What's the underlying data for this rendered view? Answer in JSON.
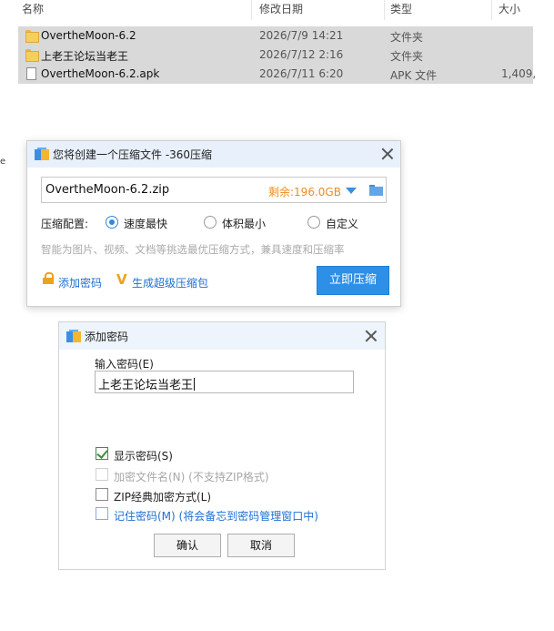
{
  "explorer": {
    "columns": [
      "名称",
      "修改日期",
      "类型",
      "大小"
    ],
    "rows": [
      {
        "name": "OvertheMoon-6.2",
        "date": "2026/7/9 14:21",
        "type": "文件夹",
        "size": "",
        "icon": "folder-icon"
      },
      {
        "name": "上老王论坛当老王",
        "date": "2026/7/12 2:16",
        "type": "文件夹",
        "size": "",
        "icon": "folder-icon"
      },
      {
        "name": "OvertheMoon-6.2.apk",
        "date": "2026/7/11 6:20",
        "type": "APK 文件",
        "size": "1,409,",
        "icon": "file-icon"
      }
    ]
  },
  "compress_dialog": {
    "title": "您将创建一个压缩文件 -360压缩",
    "path_value": "OvertheMoon-6.2.zip",
    "free_space": "剩余:196.0GB",
    "config_label": "压缩配置:",
    "options": [
      "速度最快",
      "体积最小",
      "自定义"
    ],
    "selected_option": "速度最快",
    "hint": "智能为图片、视频、文档等挑选最优压缩方式，兼具速度和压缩率",
    "add_password": "添加密码",
    "super_pack": "生成超级压缩包",
    "compress_now": "立即压缩",
    "colors": {
      "accent": "#2d8fe6",
      "free_space": "#f08a1c",
      "link": "#1f6fd1"
    }
  },
  "password_dialog": {
    "title": "添加密码",
    "input_label": "输入密码(E)",
    "password_value": "上老王论坛当老王",
    "checkboxes": [
      {
        "label": "显示密码(S)",
        "checked": true,
        "disabled": false
      },
      {
        "label": "加密文件名(N) (不支持ZIP格式)",
        "checked": false,
        "disabled": true
      },
      {
        "label": "ZIP经典加密方式(L)",
        "checked": false,
        "disabled": false
      },
      {
        "label": "记住密码(M) (将会备忘到密码管理窗口中)",
        "checked": false,
        "disabled": false
      }
    ],
    "ok": "确认",
    "cancel": "取消"
  },
  "stray_glyph": "e"
}
